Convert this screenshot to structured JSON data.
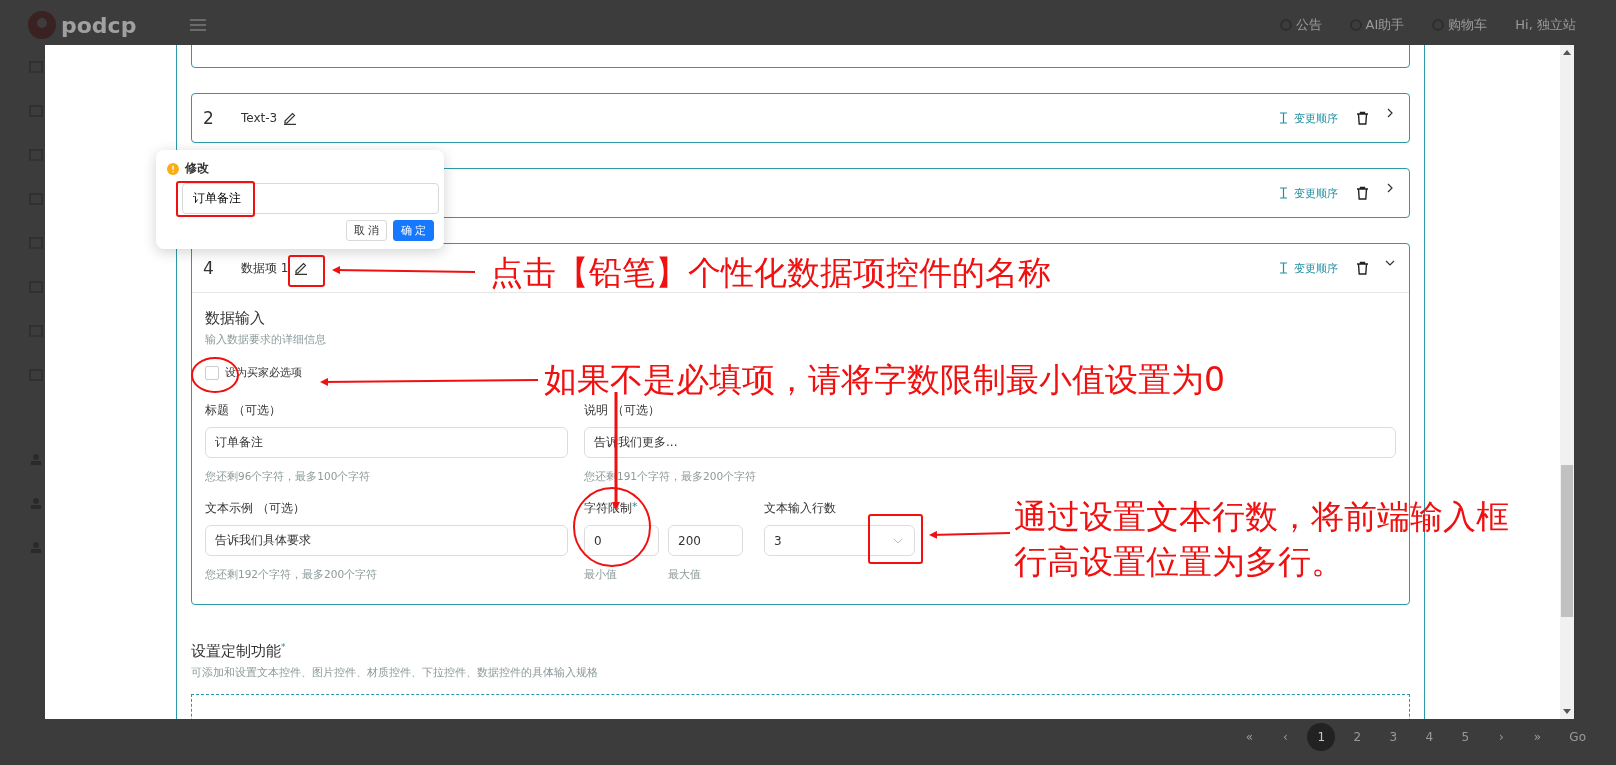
{
  "header": {
    "logo": "podcp",
    "links": [
      {
        "label": "公告"
      },
      {
        "label": "AI助手"
      },
      {
        "label": "购物车"
      }
    ],
    "greeting": "Hi, 独立站"
  },
  "items": [
    {
      "number": "2",
      "label": "Text-3",
      "reorder": "变更顺序",
      "expanded": false
    },
    {
      "reorder": "变更顺序",
      "expanded": false
    },
    {
      "number": "4",
      "label": "数据项 1",
      "reorder": "变更顺序",
      "expanded": true
    }
  ],
  "popup": {
    "title": "修改",
    "value": "订单备注",
    "cancel": "取消",
    "confirm": "确定"
  },
  "data_input": {
    "title": "数据输入",
    "subtitle": "输入数据要求的详细信息",
    "required": {
      "label": "设为买家必选项",
      "checked": false
    },
    "title_field": {
      "label": "标题 （可选）",
      "value": "订单备注",
      "hint": "您还剩96个字符，最多100个字符"
    },
    "description_field": {
      "label": "说明 （可选）",
      "value": "告诉我们更多...",
      "hint": "您还剩191个字符，最多200个字符"
    },
    "example_field": {
      "label": "文本示例 （可选）",
      "value": "告诉我们具体要求",
      "hint": "您还剩192个字符，最多200个字符"
    },
    "char_limit": {
      "label": "字符限制",
      "mark": "*",
      "min": "0",
      "max": "200",
      "min_label": "最小值",
      "max_label": "最大值"
    },
    "rows": {
      "label": "文本输入行数",
      "value": "3"
    }
  },
  "section": {
    "title": "设置定制功能",
    "mark": "*",
    "subtitle": "可添加和设置文本控件、图片控件、材质控件、下拉控件、数据控件的具体输入规格"
  },
  "annotations": [
    {
      "lines": [
        "点击【铅笔】个性化数据项控件的名称"
      ]
    },
    {
      "lines": [
        "如果不是必填项，请将字数限制最小值设置为0"
      ]
    },
    {
      "lines": [
        "通过设置文本行数，将前端输入框",
        "行高设置位置为多行。"
      ]
    }
  ],
  "pagination": {
    "pages": [
      {
        "label": "«",
        "selected": false
      },
      {
        "label": "‹",
        "selected": false
      },
      {
        "label": "1",
        "selected": true
      },
      {
        "label": "2",
        "selected": false
      },
      {
        "label": "3",
        "selected": false
      },
      {
        "label": "4",
        "selected": false
      },
      {
        "label": "5",
        "selected": false
      },
      {
        "label": "›",
        "selected": false
      },
      {
        "label": "»",
        "selected": false
      }
    ],
    "go": "Go"
  }
}
